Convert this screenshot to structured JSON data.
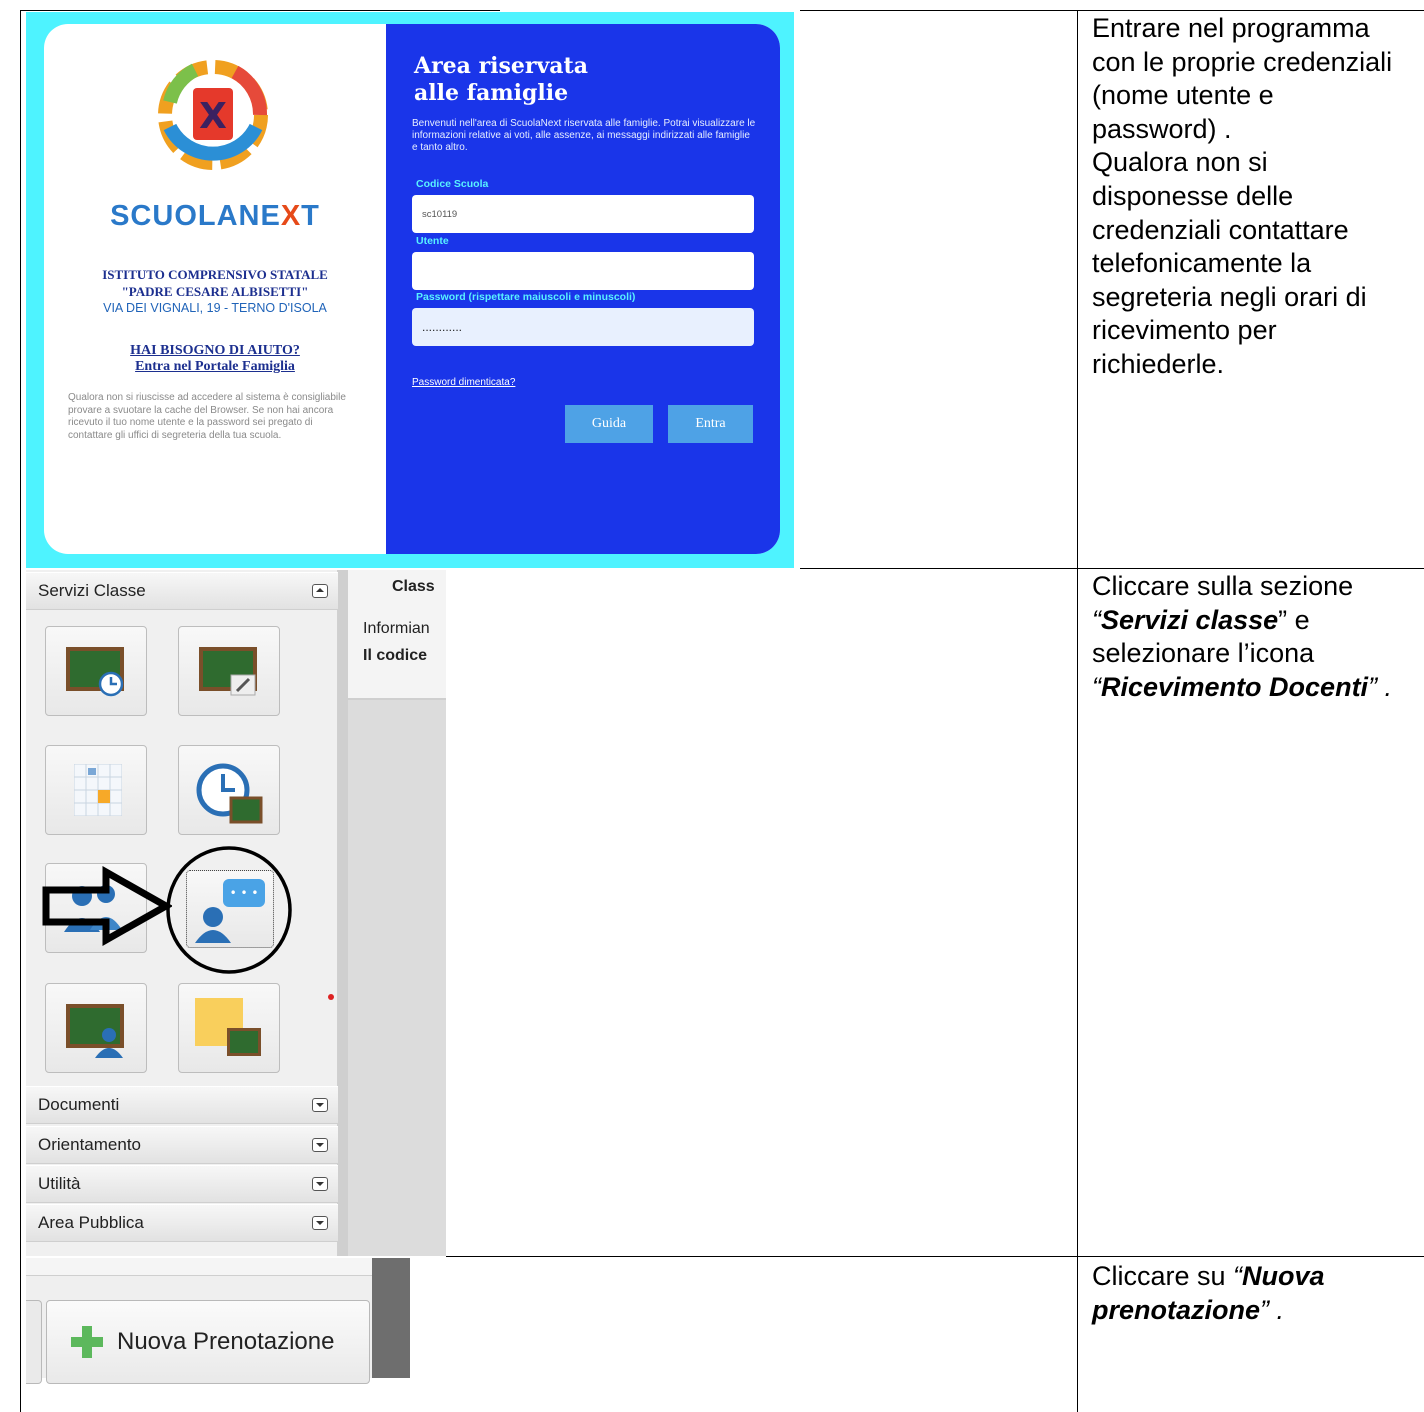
{
  "rows": [
    {
      "instruction": "Entrare nel programma\ncon le proprie credenziali\n(nome utente e\npassword) .\nQualora non si\ndisponesse delle\ncredenziali contattare\ntelefonicamente la\nsegreteria negli orari di\nricevimento per\nrichiederle."
    },
    {
      "instruction_parts": [
        "Cliccare sulla sezione",
        "“",
        "Servizi classe",
        "” e",
        "selezionare l’icona",
        "“",
        "Ricevimento Docenti",
        "” ."
      ]
    },
    {
      "instruction_parts": [
        "Cliccare su ",
        "“",
        "Nuova",
        "prenotazione",
        "” ."
      ]
    }
  ],
  "login": {
    "brand_a": "SCUOLANE",
    "brand_b": "X",
    "brand_c": "T",
    "school_line1": "ISTITUTO COMPRENSIVO STATALE",
    "school_line2": "\"PADRE CESARE ALBISETTI\"",
    "school_line3": "VIA DEI VIGNALI, 19 - TERNO D'ISOLA",
    "help_line1": "HAI BISOGNO DI AIUTO?",
    "help_line2": "Entra nel Portale Famiglia",
    "note": "Qualora non si riuscisse ad accedere al sistema è consigliabile provare a svuotare la cache del Browser. Se non hai ancora ricevuto il tuo nome utente e la password sei pregato di contattare gli uffici di segreteria della tua scuola.",
    "title_line1": "Area riservata",
    "title_line2": "alle famiglie",
    "welcome": "Benvenuti nell'area di ScuolaNext riservata alle famiglie. Potrai visualizzare le informazioni relative ai voti, alle assenze, ai messaggi indirizzati alle famiglie e tanto altro.",
    "label_code": "Codice Scuola",
    "value_code": "sc10119",
    "label_user": "Utente",
    "value_user": "",
    "label_password": "Password (rispettare maiuscoli e minuscoli)",
    "value_password": "............",
    "forgot": "Password dimenticata?",
    "btn_help": "Guida",
    "btn_enter": "Entra"
  },
  "menu": {
    "section_open": "Servizi Classe",
    "sections_closed": [
      "Documenti",
      "Orientamento",
      "Utilità",
      "Area Pubblica"
    ],
    "pane_title": "Class",
    "pane_line1": "Informian",
    "pane_line2": "Il codice"
  },
  "toolbar": {
    "new_booking": "Nuova Prenotazione"
  }
}
